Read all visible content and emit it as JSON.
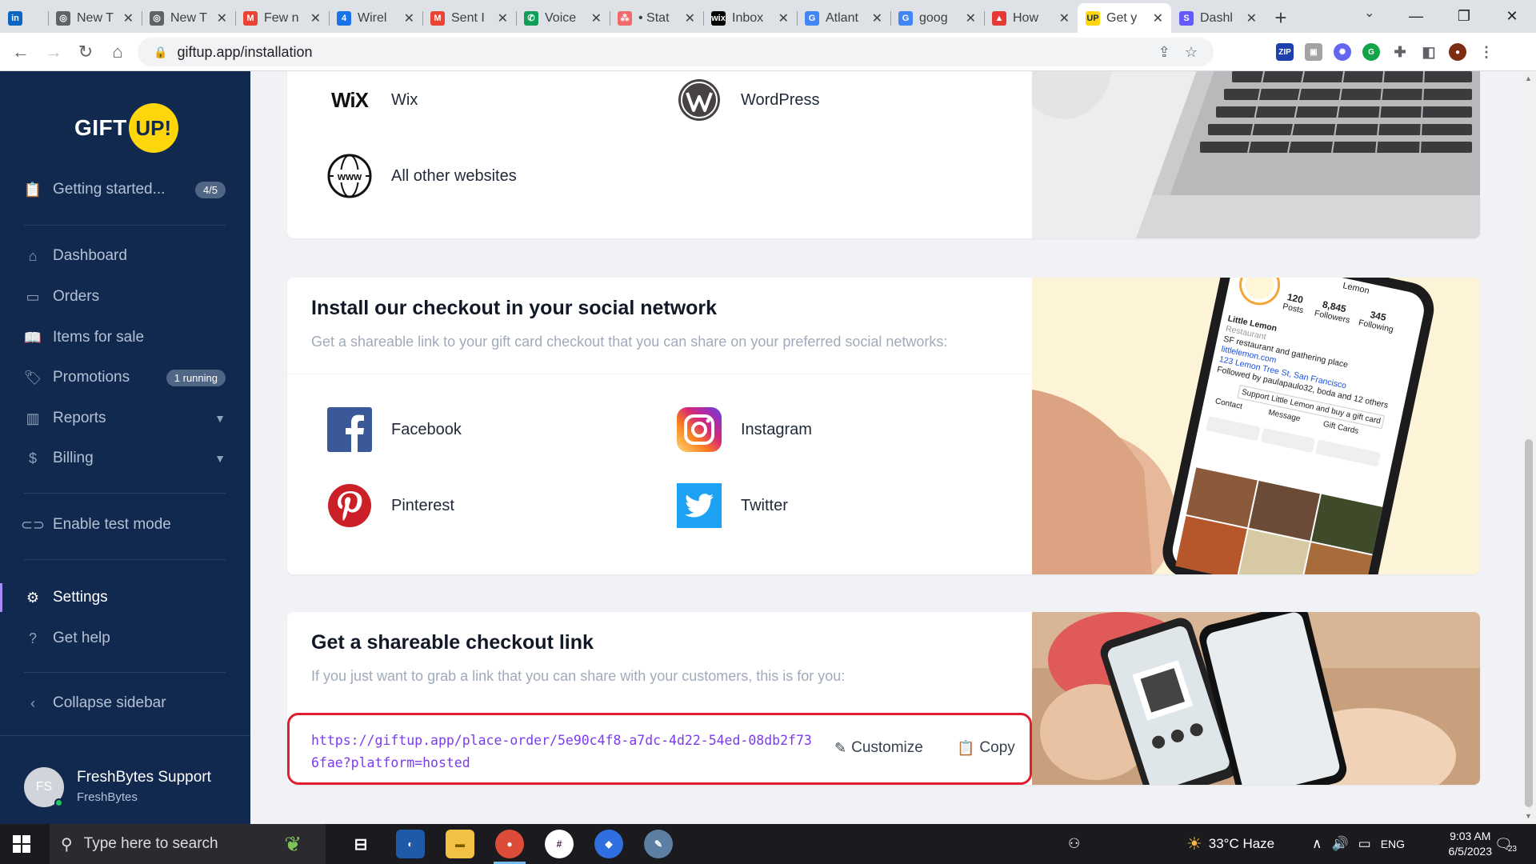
{
  "browser": {
    "tabs": [
      {
        "title": "",
        "favicon": "linkedin-icon",
        "color": "#0a66c2",
        "glyph": "in"
      },
      {
        "title": "New T",
        "favicon": "chrome-icon",
        "color": "#5f6368",
        "glyph": "◎"
      },
      {
        "title": "New T",
        "favicon": "chrome-icon",
        "color": "#5f6368",
        "glyph": "◎"
      },
      {
        "title": "Few n",
        "favicon": "gmail-icon",
        "color": "#ea4335",
        "glyph": "M"
      },
      {
        "title": "Wirel",
        "favicon": "doc-icon",
        "color": "#1a73e8",
        "glyph": "4"
      },
      {
        "title": "Sent I",
        "favicon": "gmail-icon",
        "color": "#ea4335",
        "glyph": "M"
      },
      {
        "title": "Voice",
        "favicon": "phone-icon",
        "color": "#0f9d58",
        "glyph": "✆"
      },
      {
        "title": "• Stat",
        "favicon": "asana-icon",
        "color": "#f06a6a",
        "glyph": "⁂"
      },
      {
        "title": "Inbox",
        "favicon": "wix-icon",
        "color": "#000000",
        "glyph": "wix"
      },
      {
        "title": "Atlant",
        "favicon": "google-icon",
        "color": "#4285f4",
        "glyph": "G"
      },
      {
        "title": "goog",
        "favicon": "google-icon",
        "color": "#4285f4",
        "glyph": "G"
      },
      {
        "title": "How",
        "favicon": "triangle-icon",
        "color": "#e53935",
        "glyph": "▲"
      },
      {
        "title": "Get y",
        "favicon": "giftup-icon",
        "color": "#ffd60a",
        "glyph": "UP",
        "active": true
      },
      {
        "title": "Dashl",
        "favicon": "stripe-icon",
        "color": "#635bff",
        "glyph": "S"
      }
    ],
    "url": "giftup.app/installation"
  },
  "sidebar": {
    "logo_text": "GIFT",
    "logo_badge": "UP!",
    "getting_started": {
      "label": "Getting started...",
      "badge": "4/5"
    },
    "nav": {
      "dashboard": "Dashboard",
      "orders": "Orders",
      "items_for_sale": "Items for sale",
      "promotions": "Promotions",
      "promotions_badge": "1 running",
      "reports": "Reports",
      "billing": "Billing",
      "enable_test_mode": "Enable test mode",
      "settings": "Settings",
      "get_help": "Get help",
      "collapse_sidebar": "Collapse sidebar"
    },
    "user": {
      "initials": "FS",
      "name": "FreshBytes Support",
      "org": "FreshBytes"
    }
  },
  "website_card": {
    "platforms": {
      "wix": "Wix",
      "wordpress": "WordPress",
      "other": "All other websites"
    },
    "wix_logo": "WiX",
    "www_logo": "www"
  },
  "social_card": {
    "title": "Install our checkout in your social network",
    "subtitle": "Get a shareable link to your gift card checkout that you can share on your preferred social networks:",
    "networks": {
      "facebook": "Facebook",
      "instagram": "Instagram",
      "pinterest": "Pinterest",
      "twitter": "Twitter"
    },
    "phone_profile": {
      "name": "Little Lemon",
      "type": "Restaurant",
      "bio": "SF restaurant and gathering place",
      "site": "littlelemon.com",
      "address": "123 Lemon Tree St, San Francisco",
      "followed_by": "Followed by paulapaulo32, boda and 12 others",
      "posts": "120",
      "posts_label": "Posts",
      "followers": "8,845",
      "followers_label": "Followers",
      "following": "345",
      "following_label": "Following",
      "header_name": "Lemon",
      "cta": "Support Little Lemon and buy a gift card",
      "buttons": [
        "Contact",
        "Message",
        "Gift Cards"
      ]
    }
  },
  "checkout_card": {
    "title": "Get a shareable checkout link",
    "subtitle": "If you just want to grab a link that you can share with your customers, this is for you:",
    "link": "https://giftup.app/place-order/5e90c4f8-a7dc-4d22-54ed-08db2f736fae?platform=hosted",
    "customize_label": "Customize",
    "copy_label": "Copy"
  },
  "taskbar": {
    "search_placeholder": "Type here to search",
    "weather": "33°C Haze",
    "language": "ENG",
    "time": "9:03 AM",
    "date": "6/5/2023",
    "notifications": "23"
  }
}
